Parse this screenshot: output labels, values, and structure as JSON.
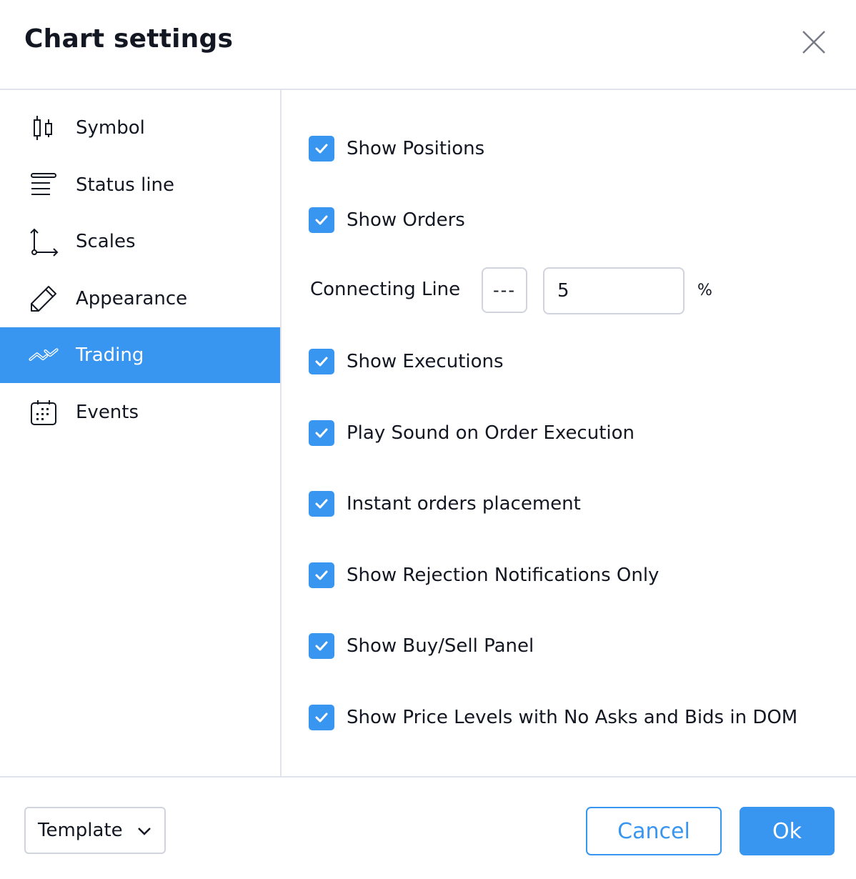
{
  "dialog": {
    "title": "Chart settings",
    "close_icon": "close-icon"
  },
  "sidebar": {
    "items": [
      {
        "label": "Symbol",
        "icon": "candlestick-icon",
        "active": false
      },
      {
        "label": "Status line",
        "icon": "status-line-icon",
        "active": false
      },
      {
        "label": "Scales",
        "icon": "scales-icon",
        "active": false
      },
      {
        "label": "Appearance",
        "icon": "pencil-icon",
        "active": false
      },
      {
        "label": "Trading",
        "icon": "trading-icon",
        "active": true
      },
      {
        "label": "Events",
        "icon": "calendar-icon",
        "active": false
      }
    ]
  },
  "trading": {
    "options": [
      {
        "label": "Show Positions",
        "checked": true
      },
      {
        "label": "Show Orders",
        "checked": true
      },
      {
        "label": "Show Executions",
        "checked": true
      },
      {
        "label": "Play Sound on Order Execution",
        "checked": true
      },
      {
        "label": "Instant orders placement",
        "checked": true
      },
      {
        "label": "Show Rejection Notifications Only",
        "checked": true
      },
      {
        "label": "Show Buy/Sell Panel",
        "checked": true
      },
      {
        "label": "Show Price Levels with No Asks and Bids in DOM",
        "checked": true
      }
    ],
    "connecting_line": {
      "label": "Connecting Line",
      "style": "---",
      "value": "5",
      "unit": "%"
    }
  },
  "footer": {
    "template_label": "Template",
    "cancel_label": "Cancel",
    "ok_label": "Ok"
  },
  "colors": {
    "accent": "#3996f0",
    "text": "#131722",
    "border": "#d1d4dc",
    "divider": "#e0e3eb"
  }
}
